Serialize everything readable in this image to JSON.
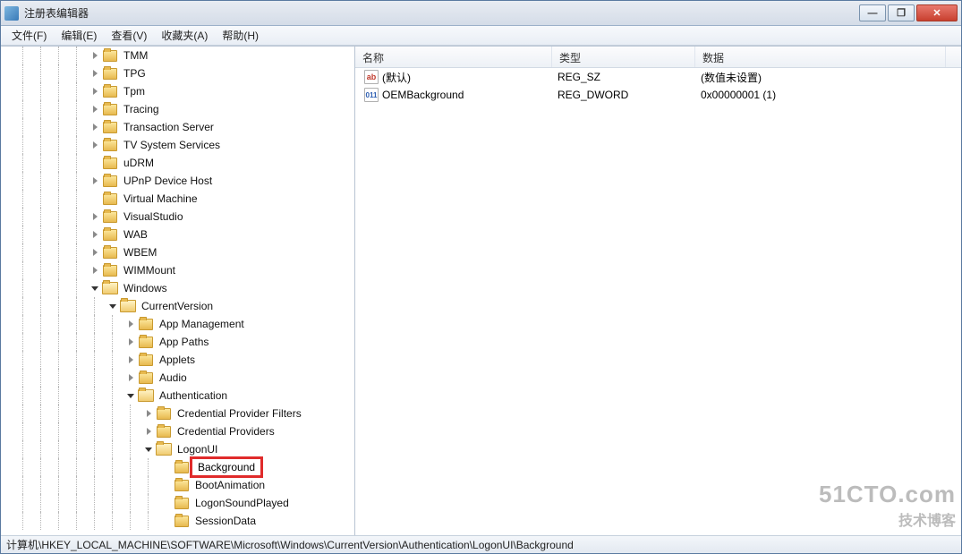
{
  "window": {
    "title": "注册表编辑器"
  },
  "menus": [
    "文件(F)",
    "编辑(E)",
    "查看(V)",
    "收藏夹(A)",
    "帮助(H)"
  ],
  "tree": [
    {
      "d": 5,
      "t": "closed",
      "l": "TMM"
    },
    {
      "d": 5,
      "t": "closed",
      "l": "TPG"
    },
    {
      "d": 5,
      "t": "closed",
      "l": "Tpm"
    },
    {
      "d": 5,
      "t": "closed",
      "l": "Tracing"
    },
    {
      "d": 5,
      "t": "closed",
      "l": "Transaction Server"
    },
    {
      "d": 5,
      "t": "closed",
      "l": "TV System Services"
    },
    {
      "d": 5,
      "t": "none",
      "l": "uDRM"
    },
    {
      "d": 5,
      "t": "closed",
      "l": "UPnP Device Host"
    },
    {
      "d": 5,
      "t": "none",
      "l": "Virtual Machine"
    },
    {
      "d": 5,
      "t": "closed",
      "l": "VisualStudio"
    },
    {
      "d": 5,
      "t": "closed",
      "l": "WAB"
    },
    {
      "d": 5,
      "t": "closed",
      "l": "WBEM"
    },
    {
      "d": 5,
      "t": "closed",
      "l": "WIMMount"
    },
    {
      "d": 5,
      "t": "open",
      "l": "Windows",
      "open": true
    },
    {
      "d": 6,
      "t": "open",
      "l": "CurrentVersion",
      "open": true
    },
    {
      "d": 7,
      "t": "closed",
      "l": "App Management"
    },
    {
      "d": 7,
      "t": "closed",
      "l": "App Paths"
    },
    {
      "d": 7,
      "t": "closed",
      "l": "Applets"
    },
    {
      "d": 7,
      "t": "closed",
      "l": "Audio"
    },
    {
      "d": 7,
      "t": "open",
      "l": "Authentication",
      "open": true
    },
    {
      "d": 8,
      "t": "closed",
      "l": "Credential Provider Filters"
    },
    {
      "d": 8,
      "t": "closed",
      "l": "Credential Providers"
    },
    {
      "d": 8,
      "t": "open",
      "l": "LogonUI",
      "open": true
    },
    {
      "d": 9,
      "t": "none",
      "l": "Background",
      "hilite": true
    },
    {
      "d": 9,
      "t": "none",
      "l": "BootAnimation"
    },
    {
      "d": 9,
      "t": "none",
      "l": "LogonSoundPlayed"
    },
    {
      "d": 9,
      "t": "none",
      "l": "SessionData"
    }
  ],
  "cols": {
    "name": "名称",
    "type": "类型",
    "data": "数据"
  },
  "colw": {
    "name": 220,
    "type": 160,
    "data": 280
  },
  "values": [
    {
      "ico": "ab",
      "name": "(默认)",
      "type": "REG_SZ",
      "data": "(数值未设置)"
    },
    {
      "ico": "dw",
      "name": "OEMBackground",
      "type": "REG_DWORD",
      "data": "0x00000001 (1)"
    }
  ],
  "ico_text": {
    "ab": "ab",
    "dw": "011"
  },
  "status": "计算机\\HKEY_LOCAL_MACHINE\\SOFTWARE\\Microsoft\\Windows\\CurrentVersion\\Authentication\\LogonUI\\Background",
  "watermark": {
    "big": "51CTO.com",
    "small": "技术博客"
  },
  "winbtns": {
    "min": "—",
    "max": "❐",
    "close": "✕"
  }
}
